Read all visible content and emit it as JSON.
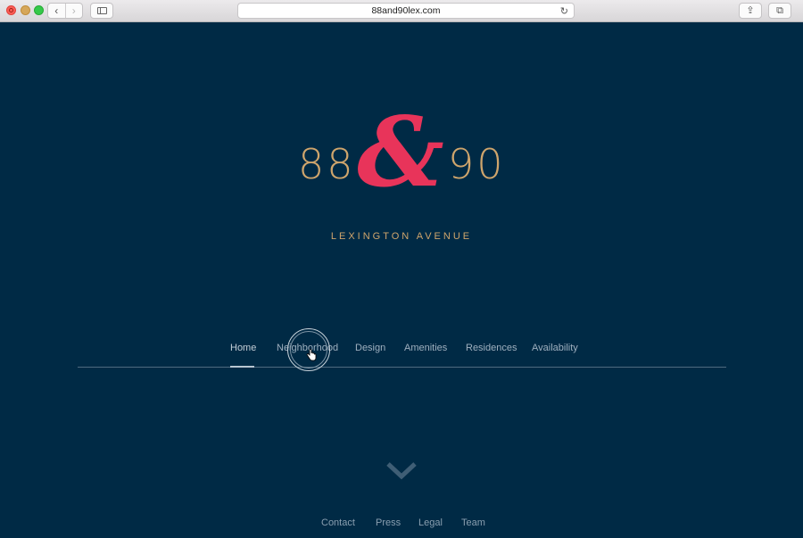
{
  "browser": {
    "url": "88and90lex.com",
    "back_icon": "‹",
    "forward_icon": "›",
    "reload_icon": "↻",
    "share_icon": "⇪",
    "tabs_icon": "⧉"
  },
  "logo": {
    "number_left": "88",
    "ampersand": "&",
    "number_right": "90",
    "subtitle": "LEXINGTON AVENUE",
    "colors": {
      "gold": "#cfa56c",
      "red": "#e8345a"
    }
  },
  "main_nav": {
    "items": [
      {
        "label": "Home",
        "active": true
      },
      {
        "label": "Neighborhood",
        "active": false
      },
      {
        "label": "Design",
        "active": false
      },
      {
        "label": "Amenities",
        "active": false
      },
      {
        "label": "Residences",
        "active": false
      },
      {
        "label": "Availability",
        "active": false
      }
    ]
  },
  "footer_nav": {
    "items": [
      {
        "label": "Contact"
      },
      {
        "label": "Press"
      },
      {
        "label": "Legal"
      },
      {
        "label": "Team"
      }
    ]
  },
  "theme": {
    "background": "#002a45",
    "nav_text": "#9fb0bf",
    "rule": "#4f6b80"
  },
  "cursor": {
    "icon": "hand-pointer"
  }
}
